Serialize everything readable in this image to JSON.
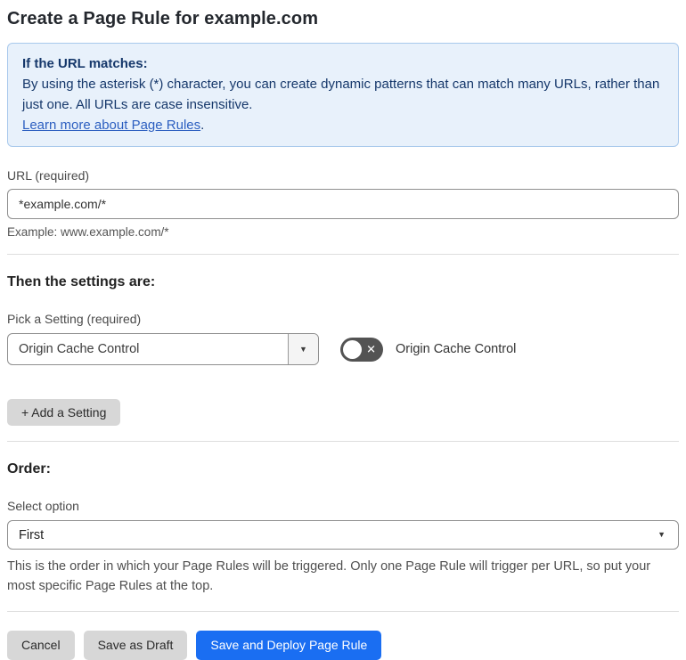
{
  "page": {
    "title": "Create a Page Rule for example.com"
  },
  "info_box": {
    "heading": "If the URL matches:",
    "body": "By using the asterisk (*) character, you can create dynamic patterns that can match many URLs, rather than just one. All URLs are case insensitive.",
    "link_label": "Learn more about Page Rules",
    "link_suffix": "."
  },
  "url_section": {
    "label": "URL (required)",
    "input_value": "*example.com/*",
    "example": "Example: www.example.com/*"
  },
  "settings_section": {
    "heading": "Then the settings are:",
    "picker_label": "Pick a Setting (required)",
    "selected_setting": "Origin Cache Control",
    "toggle_state": "off",
    "toggle_label": "Origin Cache Control",
    "add_button_label": "+ Add a Setting"
  },
  "order_section": {
    "heading": "Order:",
    "select_label": "Select option",
    "selected_option": "First",
    "help_text": "This is the order in which your Page Rules will be triggered. Only one Page Rule will trigger per URL, so put your most specific Page Rules at the top."
  },
  "footer": {
    "cancel_label": "Cancel",
    "save_draft_label": "Save as Draft",
    "save_deploy_label": "Save and Deploy Page Rule"
  },
  "icons": {
    "dropdown_caret": "▼",
    "toggle_off_x": "✕"
  },
  "colors": {
    "info_bg": "#e8f1fb",
    "info_border": "#a9c9ec",
    "info_text": "#16386b",
    "link_blue": "#2c5fc0",
    "primary_blue": "#1a6ef2",
    "toggle_off_gray": "#535353",
    "button_gray": "#d7d7d7"
  }
}
